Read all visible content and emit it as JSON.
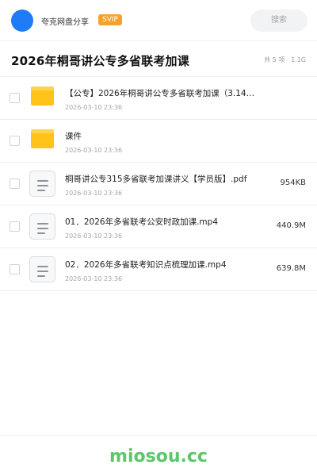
{
  "topbar": {
    "username": "夸克网盘分享",
    "badge": "SVIP",
    "search_placeholder": "搜索",
    "avatar_color": "#1f7cf6"
  },
  "header": {
    "title": "2026年桐哥讲公专多省联考加课",
    "summary": "共 5 项 · 1.1G"
  },
  "files": [
    {
      "icon": "folder-icon",
      "name": "【公专】2026年桐哥讲公专多省联考加课（3.14…",
      "date": "2026-03-10 23:36",
      "size": ""
    },
    {
      "icon": "folder-icon",
      "name": "课件",
      "date": "2026-03-10 23:36",
      "size": ""
    },
    {
      "icon": "file-icon",
      "name": "桐哥讲公专315多省联考加课讲义【学员版】.pdf",
      "date": "2026-03-10 23:36",
      "size": "954KB"
    },
    {
      "icon": "file-icon",
      "name": "01．2026年多省联考公安时政加课.mp4",
      "date": "2026-03-10 23:36",
      "size": "440.9M"
    },
    {
      "icon": "file-icon",
      "name": "02．2026年多省联考知识点梳理加课.mp4",
      "date": "2026-03-10 23:36",
      "size": "639.8M"
    }
  ],
  "footer": {
    "brand": "miosou.cc",
    "brand_color": "#5cc66a"
  }
}
